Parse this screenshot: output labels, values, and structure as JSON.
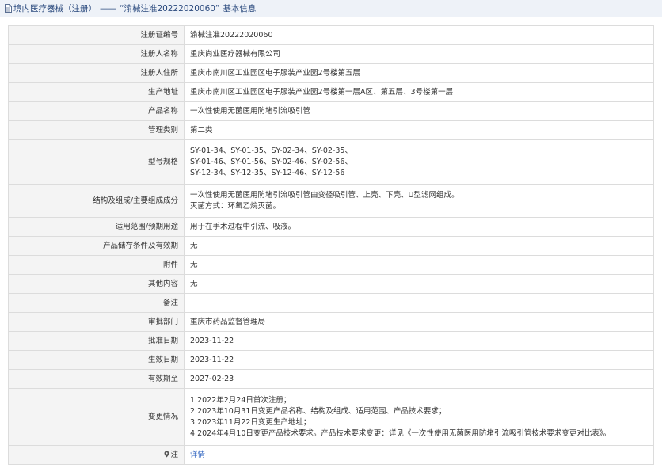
{
  "header": {
    "title_prefix": "境内医疗器械（注册）",
    "title_sep": "——",
    "title_number": "“渝械注准20222020060”",
    "title_suffix": "基本信息"
  },
  "colors": {
    "accent": "#2b4a7e",
    "link": "#2e63c0",
    "label_bg": "#f4f4f4",
    "border": "#dcdcdc"
  },
  "rows": [
    {
      "label": "注册证编号",
      "value": "渝械注准20222020060"
    },
    {
      "label": "注册人名称",
      "value": "重庆尚业医疗器械有限公司"
    },
    {
      "label": "注册人住所",
      "value": "重庆市南川区工业园区电子服装产业园2号楼第五层"
    },
    {
      "label": "生产地址",
      "value": "重庆市南川区工业园区电子服装产业园2号楼第一层A区、第五层、3号楼第一层"
    },
    {
      "label": "产品名称",
      "value": "一次性使用无菌医用防堵引流吸引管"
    },
    {
      "label": "管理类别",
      "value": "第二类"
    },
    {
      "label": "型号规格",
      "lines": [
        "SY-01-34、SY-01-35、SY-02-34、SY-02-35、",
        "SY-01-46、SY-01-56、SY-02-46、SY-02-56、",
        "SY-12-34、SY-12-35、SY-12-46、SY-12-56"
      ]
    },
    {
      "label": "结构及组成/主要组成成分",
      "lines": [
        "一次性使用无菌医用防堵引流吸引管由变径吸引管、上壳、下壳、U型滤网组成。",
        "灭菌方式：环氧乙烷灭菌。"
      ]
    },
    {
      "label": "适用范围/预期用途",
      "value": "用于在手术过程中引流、吸液。"
    },
    {
      "label": "产品储存条件及有效期",
      "value": "无"
    },
    {
      "label": "附件",
      "value": "无"
    },
    {
      "label": "其他内容",
      "value": "无"
    },
    {
      "label": "备注",
      "value": ""
    },
    {
      "label": "审批部门",
      "value": "重庆市药品监督管理局"
    },
    {
      "label": "批准日期",
      "value": "2023-11-22"
    },
    {
      "label": "生效日期",
      "value": "2023-11-22"
    },
    {
      "label": "有效期至",
      "value": "2027-02-23"
    },
    {
      "label": "变更情况",
      "lines": [
        "1.2022年2月24日首次注册；",
        "2.2023年10月31日变更产品名称、结构及组成、适用范围、产品技术要求；",
        "3.2023年11月22日变更生产地址；",
        "4.2024年4月10日变更产品技术要求。产品技术要求变更：详见《一次性使用无菌医用防堵引流吸引管技术要求变更对比表》。"
      ]
    },
    {
      "label": "注",
      "value": "详情",
      "icon": "location-pin-icon"
    }
  ]
}
